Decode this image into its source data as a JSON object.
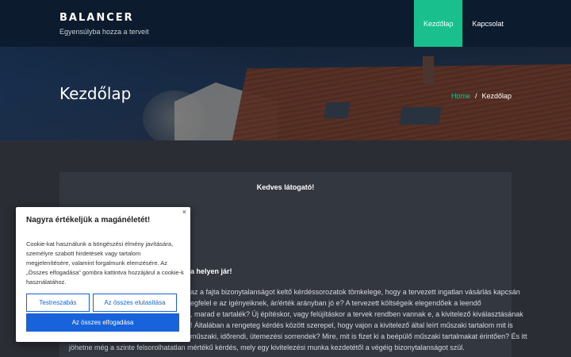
{
  "header": {
    "brand_title": "BALANCER",
    "brand_tagline": "Egyensúlyba hozza a terveit",
    "nav": [
      {
        "label": "Kezdőlap",
        "active": true
      },
      {
        "label": "Kapcsolat",
        "active": false
      }
    ],
    "accent_color": "#19c08e"
  },
  "hero": {
    "title": "Kezdőlap",
    "breadcrumb": {
      "home": "Home",
      "separator": "/",
      "current": "Kezdőlap"
    }
  },
  "content": {
    "greeting": "Kedves látogató!",
    "question_line": "",
    "bold_line": "a helyen jár!",
    "paragraph_lines": [
      "az a fajta bizonytalanságot keltő kérdéssorozatok tömkelege, hogy a tervezett ingatlan vásárlás kapcsán",
      "egfelel e az igényeiknek, ár/érték arányban jó e? A tervezett költségeik elegendőek a leendő",
      ", marad e tartalék? Új építéskor, vagy felújításkor a tervek rendben vannak e, a kivitelező kiválasztásának",
      "! Általában a rengeteg kérdés között szerepel, hogy vajon a kivitelező által leírt műszaki tartalom mit is",
      "műszaki, időrendi, ütemezési sorrendek? Mire, mit is fizet ki a beépülő műszaki tartalmakat érintően? És itt",
      "jöhetne még a szinte felsorolhatatlan mértékű kérdés, mely egy kivitelezési munka kezdetétől a végéig bizonytalanságot szül."
    ]
  },
  "cookie": {
    "close": "×",
    "title": "Nagyra értékeljük a magánéletét!",
    "body": "Cookie-kat használunk a böngészési élmény javítására, személyre szabott hirdetések vagy tartalom megjelenítésére, valamint forgalmunk elemzésére. Az „Összes elfogadása” gombra kattintva hozzájárul a cookie-k használatához.",
    "customize_label": "Testreszabás",
    "reject_label": "Az összes elutasítása",
    "accept_label": "Az összes elfogadása",
    "button_color": "#1863dc"
  }
}
